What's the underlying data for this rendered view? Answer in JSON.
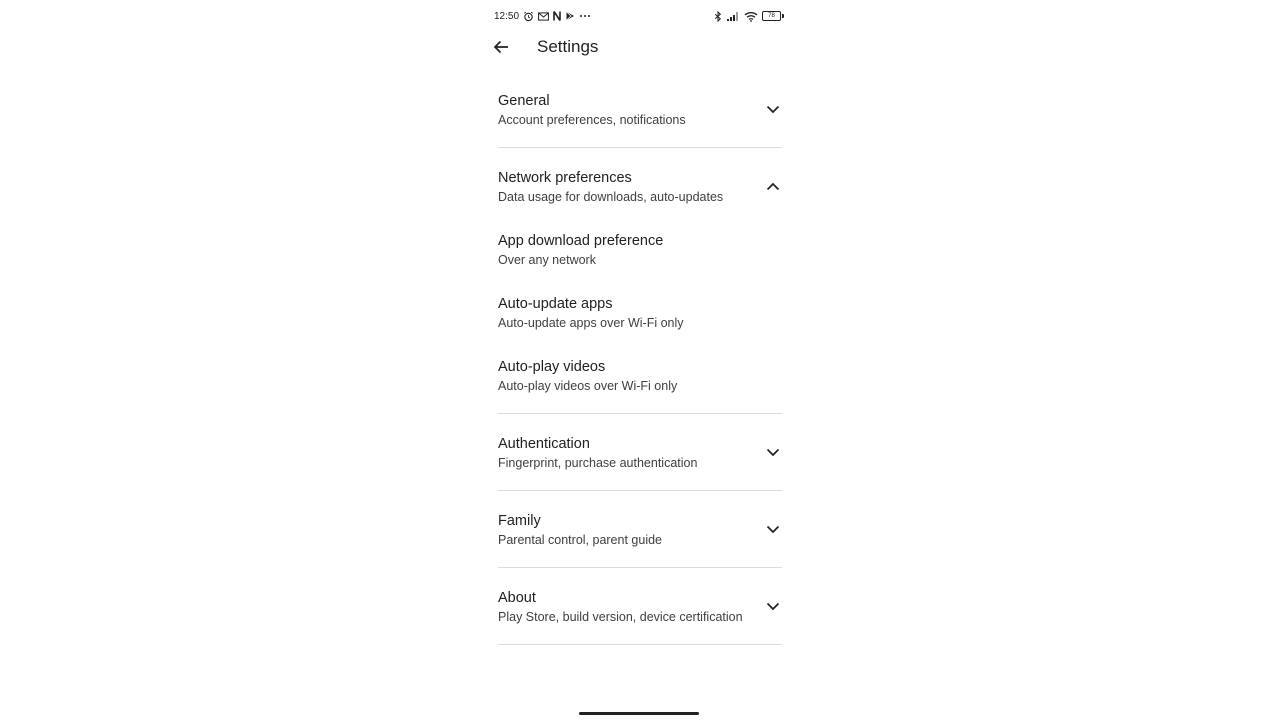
{
  "status_bar": {
    "time": "12:50",
    "battery": "78"
  },
  "header": {
    "title": "Settings"
  },
  "sections": {
    "general": {
      "title": "General",
      "subtitle": "Account preferences, notifications"
    },
    "network": {
      "title": "Network preferences",
      "subtitle": "Data usage for downloads, auto-updates"
    },
    "authentication": {
      "title": "Authentication",
      "subtitle": "Fingerprint, purchase authentication"
    },
    "family": {
      "title": "Family",
      "subtitle": "Parental control, parent guide"
    },
    "about": {
      "title": "About",
      "subtitle": "Play Store, build version, device certification"
    }
  },
  "network_items": [
    {
      "title": "App download preference",
      "subtitle": "Over any network"
    },
    {
      "title": "Auto-update apps",
      "subtitle": "Auto-update apps over Wi-Fi only"
    },
    {
      "title": "Auto-play videos",
      "subtitle": "Auto-play videos over Wi-Fi only"
    }
  ]
}
